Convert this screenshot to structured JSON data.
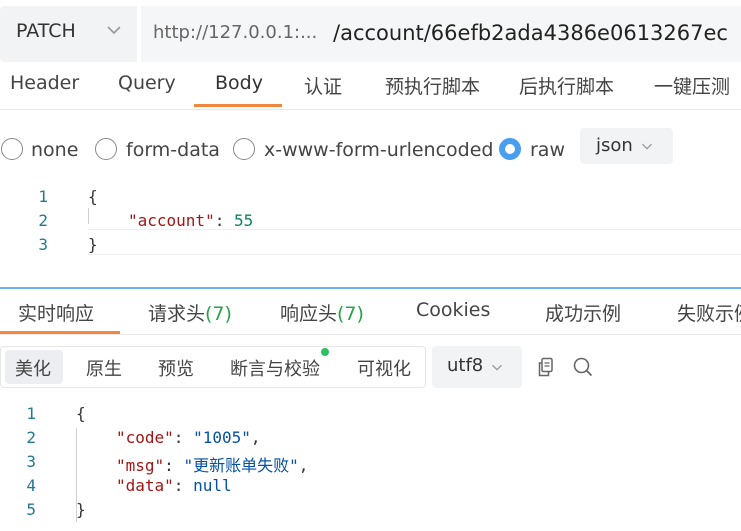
{
  "request": {
    "method": "PATCH",
    "url_host": "http://127.0.0.1:...",
    "url_path": "/account/66efb2ada4386e0613267ec"
  },
  "request_tabs": [
    "Header",
    "Query",
    "Body",
    "认证",
    "预执行脚本",
    "后执行脚本",
    "一键压测"
  ],
  "body_modes": [
    "none",
    "form-data",
    "x-www-form-urlencoded",
    "raw"
  ],
  "body_format": "json",
  "request_body": {
    "line_numbers": [
      "1",
      "2",
      "3"
    ],
    "open_brace": "{",
    "key": "\"account\"",
    "colon": ": ",
    "value": "55",
    "close_brace": "}"
  },
  "response_tabs": {
    "realtime": "实时响应",
    "req_headers": "请求头",
    "req_headers_count": "(7)",
    "resp_headers": "响应头",
    "resp_headers_count": "(7)",
    "cookies": "Cookies",
    "success_example": "成功示例",
    "fail_example": "失败示例"
  },
  "view_modes": [
    "美化",
    "原生",
    "预览",
    "断言与校验",
    "可视化"
  ],
  "encoding": "utf8",
  "response_body": {
    "line_numbers": [
      "1",
      "2",
      "3",
      "4",
      "5"
    ],
    "open_brace": "{",
    "code_key": "\"code\"",
    "code_val": "\"1005\"",
    "msg_key": "\"msg\"",
    "msg_val": "\"更新账单失败\"",
    "data_key": "\"data\"",
    "data_val": "null",
    "close_brace": "}"
  },
  "colors": {
    "accent_tab": "#f0883e",
    "radio_checked": "#4a9ef0",
    "count_green": "#2aa34a",
    "status_dot": "#2ac35e"
  },
  "icons": [
    "chevron-down-icon",
    "copy-icon",
    "search-icon"
  ]
}
